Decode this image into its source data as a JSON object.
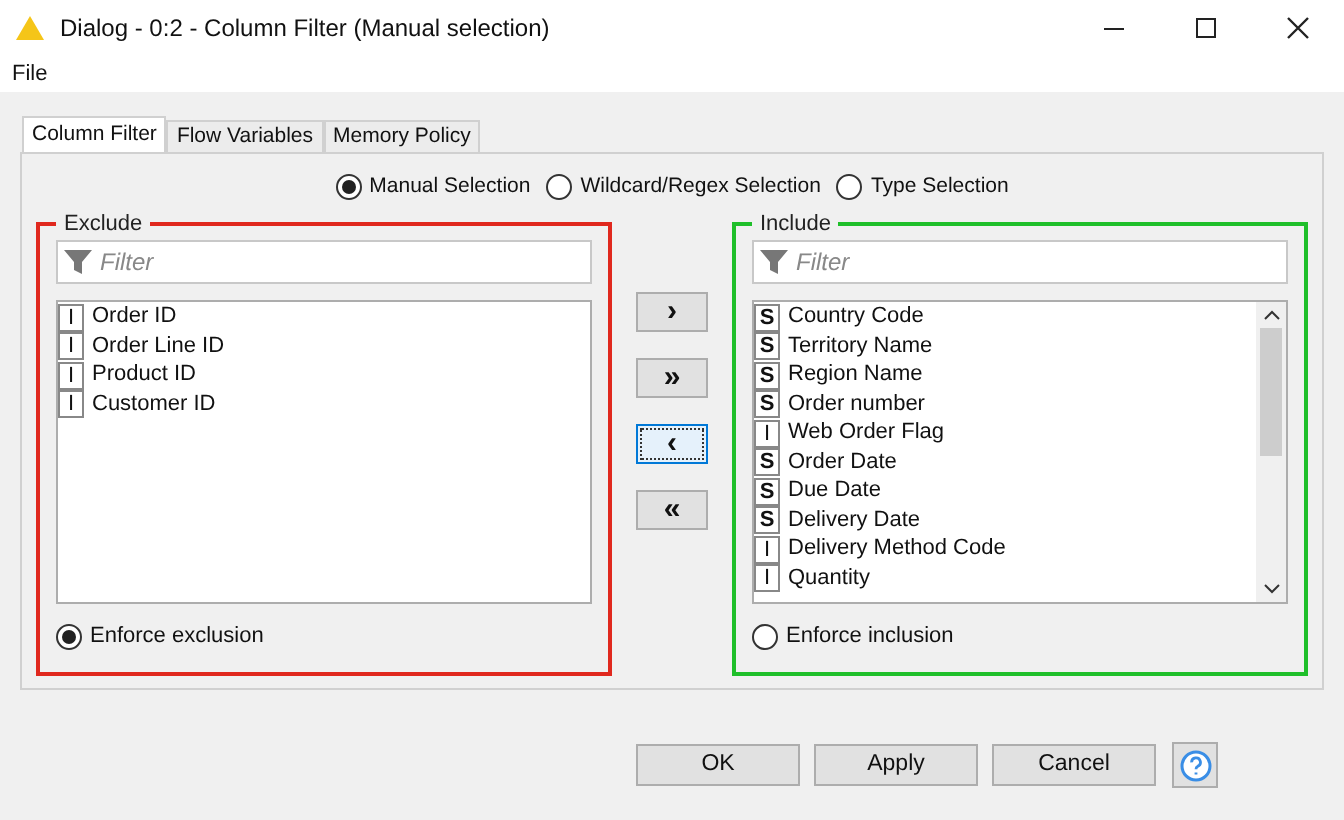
{
  "window": {
    "title": "Dialog - 0:2 - Column Filter (Manual selection)"
  },
  "menu": [
    "File"
  ],
  "tabs": [
    {
      "label": "Column Filter",
      "selected": true
    },
    {
      "label": "Flow Variables",
      "selected": false
    },
    {
      "label": "Memory Policy",
      "selected": false
    }
  ],
  "modes": [
    {
      "label": "Manual Selection",
      "selected": true
    },
    {
      "label": "Wildcard/Regex Selection",
      "selected": false
    },
    {
      "label": "Type Selection",
      "selected": false
    }
  ],
  "exclude": {
    "title": "Exclude",
    "color": "#e0281e",
    "filter": {
      "placeholder": "Filter"
    },
    "items": [
      {
        "type": "I",
        "name": "Order ID"
      },
      {
        "type": "I",
        "name": "Order Line ID"
      },
      {
        "type": "I",
        "name": "Product ID"
      },
      {
        "type": "I",
        "name": "Customer ID"
      }
    ],
    "enforce": {
      "label": "Enforce exclusion",
      "selected": true
    }
  },
  "transfer_buttons": [
    {
      "label": "›",
      "focused": false
    },
    {
      "label": "»",
      "focused": false
    },
    {
      "label": "‹",
      "focused": true
    },
    {
      "label": "«",
      "focused": false
    }
  ],
  "include": {
    "title": "Include",
    "color": "#1fbf2a",
    "filter": {
      "placeholder": "Filter"
    },
    "items": [
      {
        "type": "S",
        "name": "Country Code"
      },
      {
        "type": "S",
        "name": "Territory Name"
      },
      {
        "type": "S",
        "name": "Region Name"
      },
      {
        "type": "S",
        "name": "Order number"
      },
      {
        "type": "I",
        "name": "Web Order Flag"
      },
      {
        "type": "S",
        "name": "Order Date"
      },
      {
        "type": "S",
        "name": "Due Date"
      },
      {
        "type": "S",
        "name": "Delivery Date"
      },
      {
        "type": "I",
        "name": "Delivery Method Code"
      },
      {
        "type": "I",
        "name": "Quantity"
      }
    ],
    "enforce": {
      "label": "Enforce inclusion",
      "selected": false
    }
  },
  "buttons": [
    "OK",
    "Apply",
    "Cancel"
  ]
}
